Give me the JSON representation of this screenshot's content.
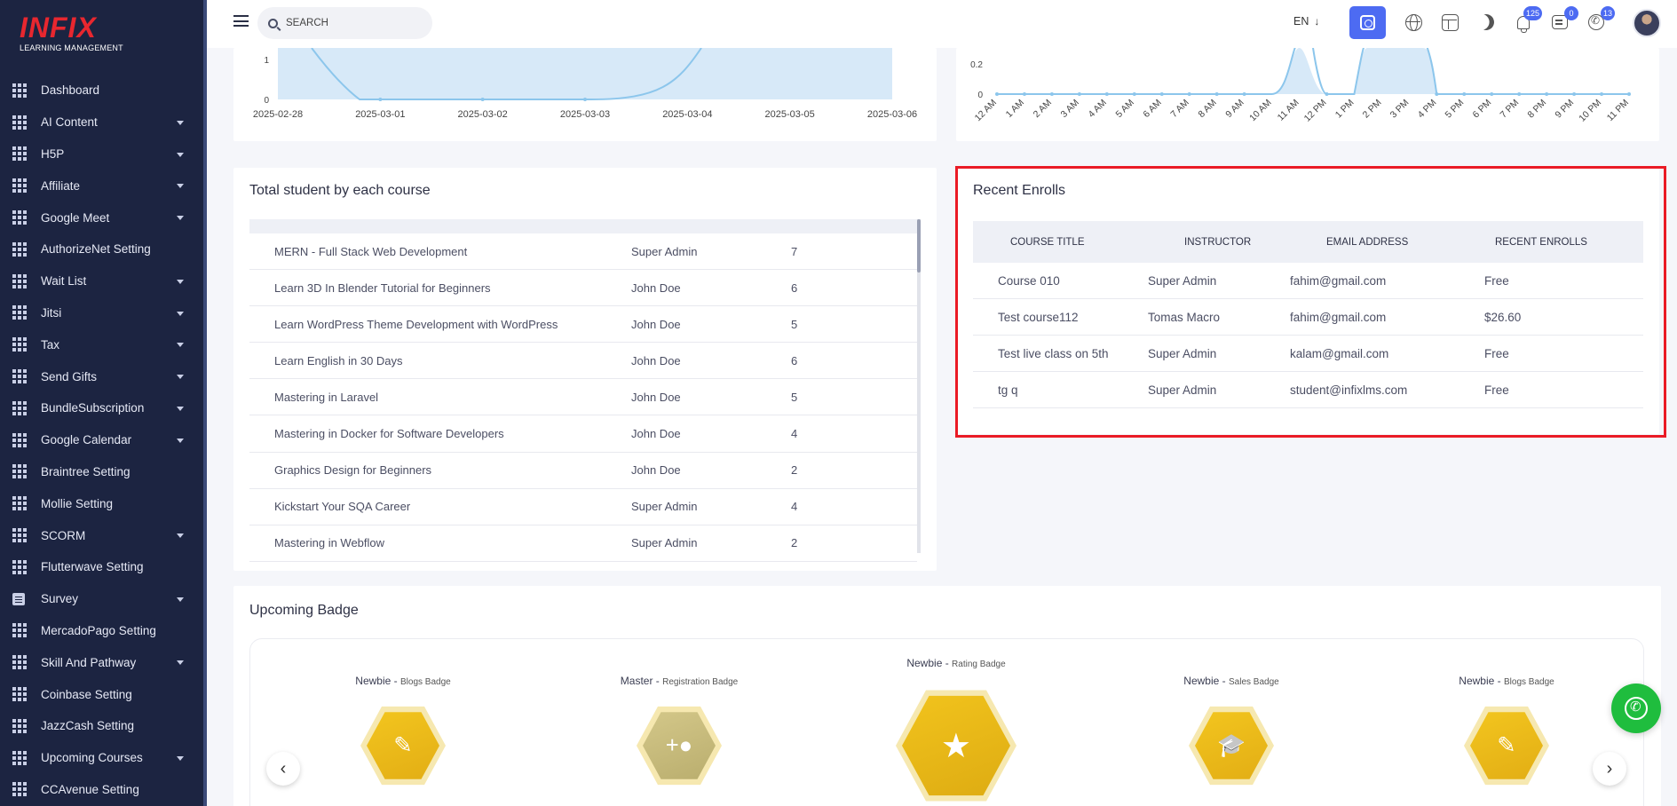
{
  "brand": {
    "name": "INFIX",
    "tagline": "LEARNING MANAGEMENT"
  },
  "sidebar": {
    "items": [
      {
        "label": "Dashboard",
        "icon": "grid-icon",
        "caret": false
      },
      {
        "label": "AI Content",
        "icon": "grid-icon",
        "caret": true
      },
      {
        "label": "H5P",
        "icon": "grid-icon",
        "caret": true
      },
      {
        "label": "Affiliate",
        "icon": "grid-icon",
        "caret": true
      },
      {
        "label": "Google Meet",
        "icon": "grid-icon",
        "caret": true
      },
      {
        "label": "AuthorizeNet Setting",
        "icon": "grid-icon",
        "caret": false
      },
      {
        "label": "Wait List",
        "icon": "grid-icon",
        "caret": true
      },
      {
        "label": "Jitsi",
        "icon": "grid-icon",
        "caret": true
      },
      {
        "label": "Tax",
        "icon": "grid-icon",
        "caret": true
      },
      {
        "label": "Send Gifts",
        "icon": "grid-icon",
        "caret": true
      },
      {
        "label": "BundleSubscription",
        "icon": "grid-icon",
        "caret": true
      },
      {
        "label": "Google Calendar",
        "icon": "grid-icon",
        "caret": true
      },
      {
        "label": "Braintree Setting",
        "icon": "grid-icon",
        "caret": false
      },
      {
        "label": "Mollie Setting",
        "icon": "grid-icon",
        "caret": false
      },
      {
        "label": "SCORM",
        "icon": "grid-icon",
        "caret": true
      },
      {
        "label": "Flutterwave Setting",
        "icon": "grid-icon",
        "caret": false
      },
      {
        "label": "Survey",
        "icon": "survey-icon",
        "caret": true
      },
      {
        "label": "MercadoPago Setting",
        "icon": "grid-icon",
        "caret": false
      },
      {
        "label": "Skill And Pathway",
        "icon": "grid-icon",
        "caret": true
      },
      {
        "label": "Coinbase Setting",
        "icon": "grid-icon",
        "caret": false
      },
      {
        "label": "JazzCash Setting",
        "icon": "grid-icon",
        "caret": false
      },
      {
        "label": "Upcoming Courses",
        "icon": "grid-icon",
        "caret": true
      },
      {
        "label": "CCAvenue Setting",
        "icon": "grid-icon",
        "caret": false
      }
    ]
  },
  "topbar": {
    "search_placeholder": "SEARCH",
    "language": "EN",
    "notification_count": "125",
    "message_count": "0",
    "phone_count": "13",
    "accent_color": "#4d6bf2"
  },
  "charts": {
    "daily": {
      "y_ticks": [
        "0",
        "1"
      ],
      "x_labels": [
        "2025-02-28",
        "2025-03-01",
        "2025-03-02",
        "2025-03-03",
        "2025-03-04",
        "2025-03-05",
        "2025-03-06"
      ]
    },
    "hourly": {
      "y_ticks": [
        "0",
        "0.2"
      ],
      "x_labels": [
        "12 AM",
        "1 AM",
        "2 AM",
        "3 AM",
        "4 AM",
        "5 AM",
        "6 AM",
        "7 AM",
        "8 AM",
        "9 AM",
        "10 AM",
        "11 AM",
        "12 PM",
        "1 PM",
        "2 PM",
        "3 PM",
        "4 PM",
        "5 PM",
        "6 PM",
        "7 PM",
        "8 PM",
        "9 PM",
        "10 PM",
        "11 PM"
      ]
    }
  },
  "courses_card": {
    "title": "Total student by each course",
    "rows": [
      {
        "course": "MERN - Full Stack Web Development",
        "instructor": "Super Admin",
        "students": "7"
      },
      {
        "course": "Learn 3D In Blender Tutorial for Beginners",
        "instructor": "John Doe",
        "students": "6"
      },
      {
        "course": "Learn WordPress Theme Development with WordPress",
        "instructor": "John Doe",
        "students": "5"
      },
      {
        "course": "Learn English in 30 Days",
        "instructor": "John Doe",
        "students": "6"
      },
      {
        "course": "Mastering in Laravel",
        "instructor": "John Doe",
        "students": "5"
      },
      {
        "course": "Mastering in Docker for Software Developers",
        "instructor": "John Doe",
        "students": "4"
      },
      {
        "course": "Graphics Design for Beginners",
        "instructor": "John Doe",
        "students": "2"
      },
      {
        "course": "Kickstart Your SQA Career",
        "instructor": "Super Admin",
        "students": "4"
      },
      {
        "course": "Mastering in Webflow",
        "instructor": "Super Admin",
        "students": "2"
      }
    ]
  },
  "enrolls_card": {
    "title": "Recent Enrolls",
    "headers": [
      "COURSE TITLE",
      "INSTRUCTOR",
      "EMAIL ADDRESS",
      "RECENT ENROLLS"
    ],
    "rows": [
      {
        "course": "Course 010",
        "instructor": "Super Admin",
        "email": "fahim@gmail.com",
        "price": "Free"
      },
      {
        "course": "Test course112",
        "instructor": "Tomas Macro",
        "email": "fahim@gmail.com",
        "price": "$26.60"
      },
      {
        "course": "Test live class on 5th",
        "instructor": "Super Admin",
        "email": "kalam@gmail.com",
        "price": "Free"
      },
      {
        "course": "tg q",
        "instructor": "Super Admin",
        "email": "student@infixlms.com",
        "price": "Free"
      }
    ],
    "highlight_color": "#ea1b25"
  },
  "badges_card": {
    "title": "Upcoming Badge",
    "badges": [
      {
        "level": "Newbie",
        "type": "Blogs Badge",
        "icon": "edit-icon"
      },
      {
        "level": "Master",
        "type": "Registration Badge",
        "icon": "add-user-icon"
      },
      {
        "level": "Newbie",
        "type": "Rating Badge",
        "icon": "star-gallery-icon"
      },
      {
        "level": "Newbie",
        "type": "Sales Badge",
        "icon": "graduate-icon"
      },
      {
        "level": "Newbie",
        "type": "Blogs Badge",
        "icon": "edit-icon"
      }
    ]
  }
}
